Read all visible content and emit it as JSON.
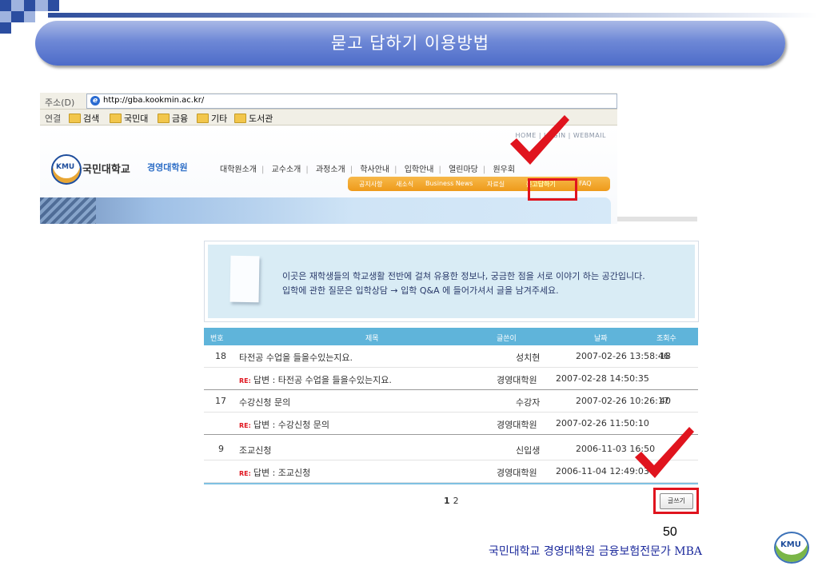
{
  "slide": {
    "title": "묻고 답하기 이용방법",
    "page_number": "50",
    "footer": "국민대학교 경영대학원 금융보험전문가 MBA",
    "footer_logo": "KMU"
  },
  "browser": {
    "address_label": "주소(D)",
    "url": "http://gba.kookmin.ac.kr/",
    "links_label": "연결",
    "links": [
      "검색",
      "국민대",
      "금융",
      "기타",
      "도서관"
    ]
  },
  "site": {
    "top_links": "HOME | LOGIN | WEBMAIL",
    "logo_badge": "KMU",
    "logo_name": "국민대학교",
    "logo_sub": "경영대학원",
    "main_nav": [
      "대학원소개",
      "교수소개",
      "과정소개",
      "학사안내",
      "입학안내",
      "열린마당",
      "원우회"
    ],
    "sub_nav": [
      "공지사항",
      "새소식",
      "Business News",
      "자료실",
      "묻고답하기",
      "FAQ"
    ]
  },
  "board": {
    "info_line1": "이곳은 재학생들의 학교생활 전반에 걸쳐 유용한 정보나, 궁금한 점을 서로 이야기 하는 공간입니다.",
    "info_line2": "입학에 관한 질문은 입학상담 → 입학 Q&A 에 들어가셔서 글을 남겨주세요.",
    "headers": {
      "no": "번호",
      "title": "제목",
      "author": "글쓴이",
      "date": "날짜",
      "views": "조회수"
    },
    "re_badge": "RE:",
    "rows": [
      {
        "no": "18",
        "title": "타전공 수업을 들을수있는지요.",
        "author": "성치현",
        "date": "2007-02-26 13:58:46",
        "views": "18"
      },
      {
        "no": "",
        "title": "답변 : 타전공 수업을 들을수있는지요.",
        "author": "경영대학원",
        "date": "2007-02-28 14:50:35",
        "views": ""
      },
      {
        "no": "17",
        "title": "수강신청 문의",
        "author": "수강자",
        "date": "2007-02-26 10:26:17",
        "views": "40"
      },
      {
        "no": "",
        "title": "답변 : 수강신청 문의",
        "author": "경영대학원",
        "date": "2007-02-26 11:50:10",
        "views": ""
      },
      {
        "no": "9",
        "title": "조교신청",
        "author": "신입생",
        "date": "2006-11-03 16:50",
        "views": ""
      },
      {
        "no": "",
        "title": "답변 : 조교신청",
        "author": "경영대학원",
        "date": "2006-11-04 12:49:03",
        "views": ""
      }
    ],
    "pages": [
      "1",
      "2"
    ],
    "write_button": "글쓰기"
  },
  "colors": {
    "banner": "#4d6cc9",
    "highlight_red": "#e0141e",
    "table_header": "#5fb4da",
    "footer_text": "#1c2a9c"
  }
}
